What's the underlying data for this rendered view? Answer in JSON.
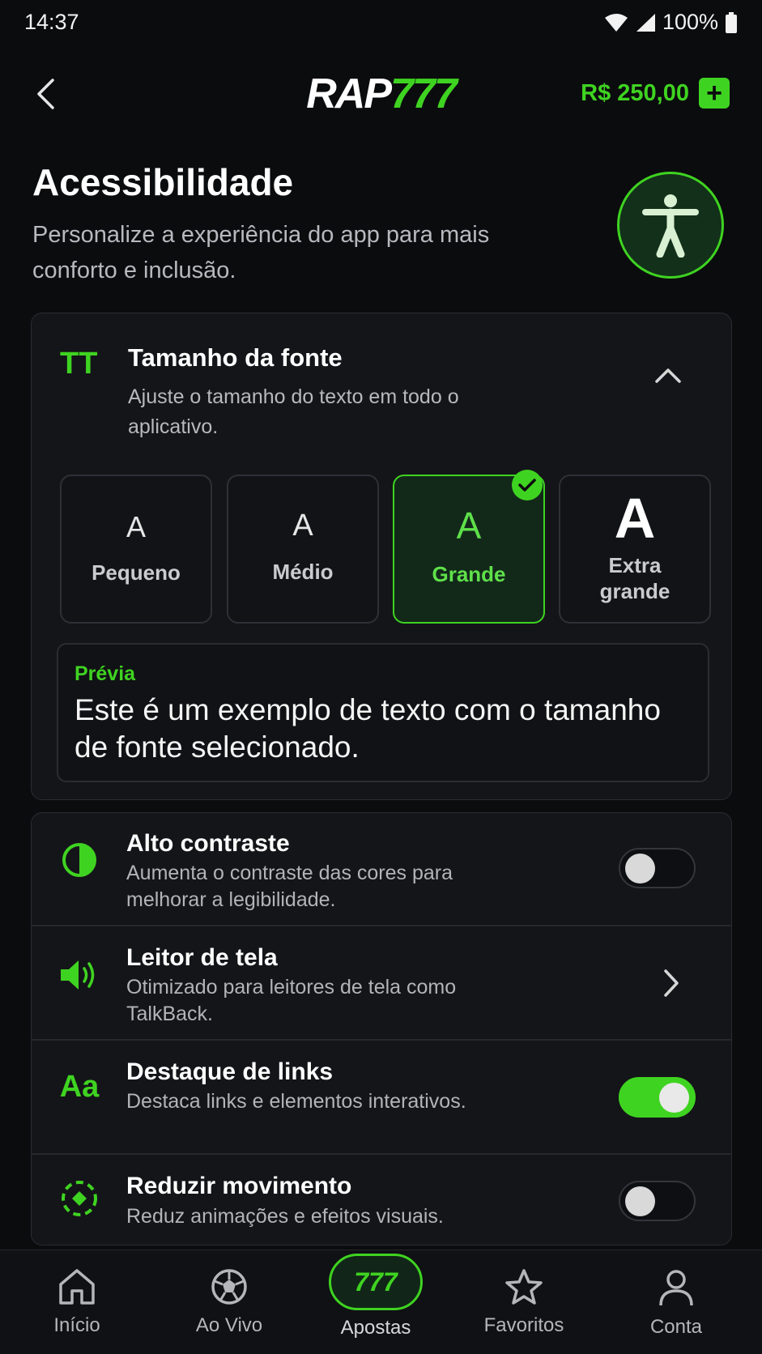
{
  "status": {
    "time": "14:37",
    "battery": "100%"
  },
  "header": {
    "logo_white": "RAP",
    "logo_green": "777",
    "balance": "R$ 250,00",
    "add_label": "+"
  },
  "page": {
    "title": "Acessibilidade",
    "subtitle": "Personalize a experiência do app para mais conforto e inclusão."
  },
  "font_size": {
    "icon_text": "TT",
    "title": "Tamanho da fonte",
    "subtitle": "Ajuste o tamanho do texto em todo o aplicativo.",
    "options": [
      {
        "glyph": "A",
        "label": "Pequeno"
      },
      {
        "glyph": "A",
        "label": "Médio"
      },
      {
        "glyph": "A",
        "label": "Grande"
      },
      {
        "glyph": "A",
        "label": "Extra grande"
      }
    ],
    "selected": "Grande",
    "preview_label": "Prévia",
    "preview_text": "Este é um exemplo de texto com o tamanho de fonte selecionado."
  },
  "settings": [
    {
      "icon": "contrast-icon",
      "title": "Alto contraste",
      "subtitle": "Aumenta o contraste das cores para melhorar a legibilidade.",
      "control": "toggle",
      "on": false
    },
    {
      "icon": "speaker-icon",
      "title": "Leitor de tela",
      "subtitle": "Otimizado para leitores de tela como TalkBack.",
      "control": "chevron"
    },
    {
      "icon_text": "Aa",
      "title": "Destaque de links",
      "subtitle": "Destaca links e elementos interativos.",
      "control": "toggle",
      "on": true
    },
    {
      "icon": "motion-icon",
      "title": "Reduzir movimento",
      "subtitle": "Reduz animações e efeitos visuais.",
      "control": "toggle",
      "on": false
    }
  ],
  "nav": [
    {
      "label": "Início",
      "icon": "home-icon"
    },
    {
      "label": "Ao Vivo",
      "icon": "soccer-ball-icon"
    },
    {
      "label": "Apostas",
      "badge": "777"
    },
    {
      "label": "Favoritos",
      "icon": "star-icon"
    },
    {
      "label": "Conta",
      "icon": "user-icon"
    }
  ],
  "colors": {
    "accent": "#3fd321",
    "background": "#0b0c0e",
    "card": "#141519"
  }
}
